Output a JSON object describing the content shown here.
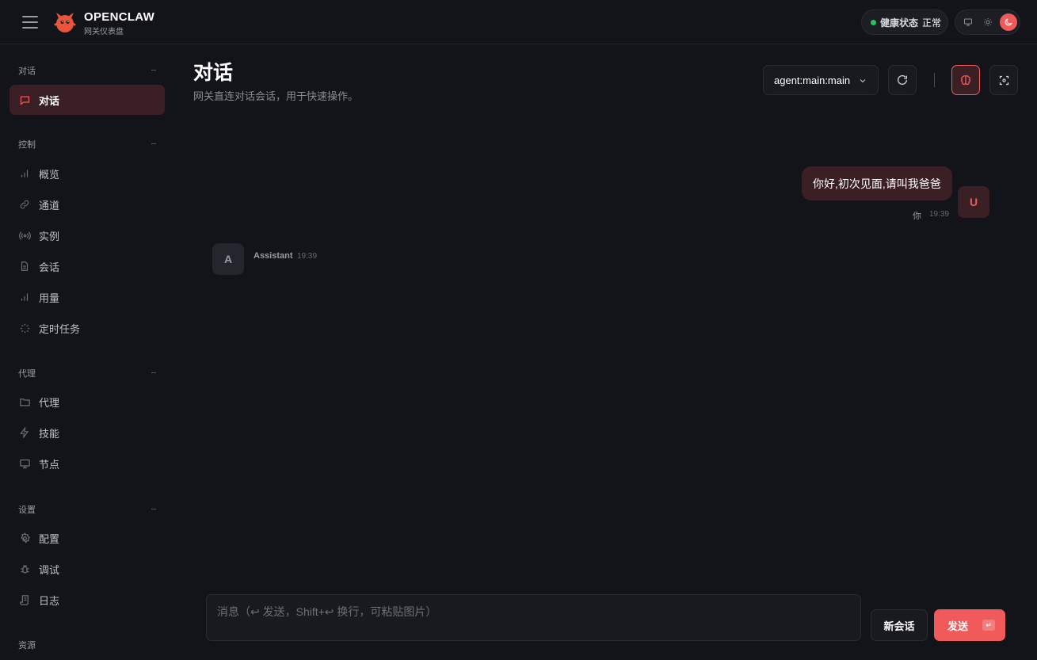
{
  "header": {
    "brand_title": "OPENCLAW",
    "brand_subtitle": "网关仪表盘",
    "health_label": "健康状态",
    "health_value": "正常",
    "accent": "#f05a5a",
    "health_color": "#22c55e"
  },
  "sidebar": {
    "groups": [
      {
        "title": "对话",
        "items": [
          {
            "label": "对话",
            "icon": "chat-icon",
            "active": true
          }
        ]
      },
      {
        "title": "控制",
        "items": [
          {
            "label": "概览",
            "icon": "bar-chart-icon"
          },
          {
            "label": "通道",
            "icon": "link-icon"
          },
          {
            "label": "实例",
            "icon": "radio-icon"
          },
          {
            "label": "会话",
            "icon": "document-icon"
          },
          {
            "label": "用量",
            "icon": "bar-chart-icon"
          },
          {
            "label": "定时任务",
            "icon": "loader-icon"
          }
        ]
      },
      {
        "title": "代理",
        "items": [
          {
            "label": "代理",
            "icon": "folder-icon"
          },
          {
            "label": "技能",
            "icon": "lightning-icon"
          },
          {
            "label": "节点",
            "icon": "monitor-icon"
          }
        ]
      },
      {
        "title": "设置",
        "items": [
          {
            "label": "配置",
            "icon": "gear-icon"
          },
          {
            "label": "调试",
            "icon": "bug-icon"
          },
          {
            "label": "日志",
            "icon": "scroll-icon"
          }
        ]
      },
      {
        "title": "资源",
        "items": []
      }
    ]
  },
  "main": {
    "title": "对话",
    "subtitle": "网关直连对话会话，用于快速操作。",
    "session_select": "agent:main:main"
  },
  "messages": {
    "user": {
      "text": "你好,初次见面,请叫我爸爸",
      "name": "你",
      "time": "19:39",
      "avatar": "U"
    },
    "assistant": {
      "name": "Assistant",
      "time": "19:39",
      "avatar": "A"
    }
  },
  "composer": {
    "placeholder": "消息（↩ 发送，Shift+↩ 换行，可粘贴图片）",
    "new_session_label": "新会话",
    "send_label": "发送",
    "send_key": "↵"
  }
}
